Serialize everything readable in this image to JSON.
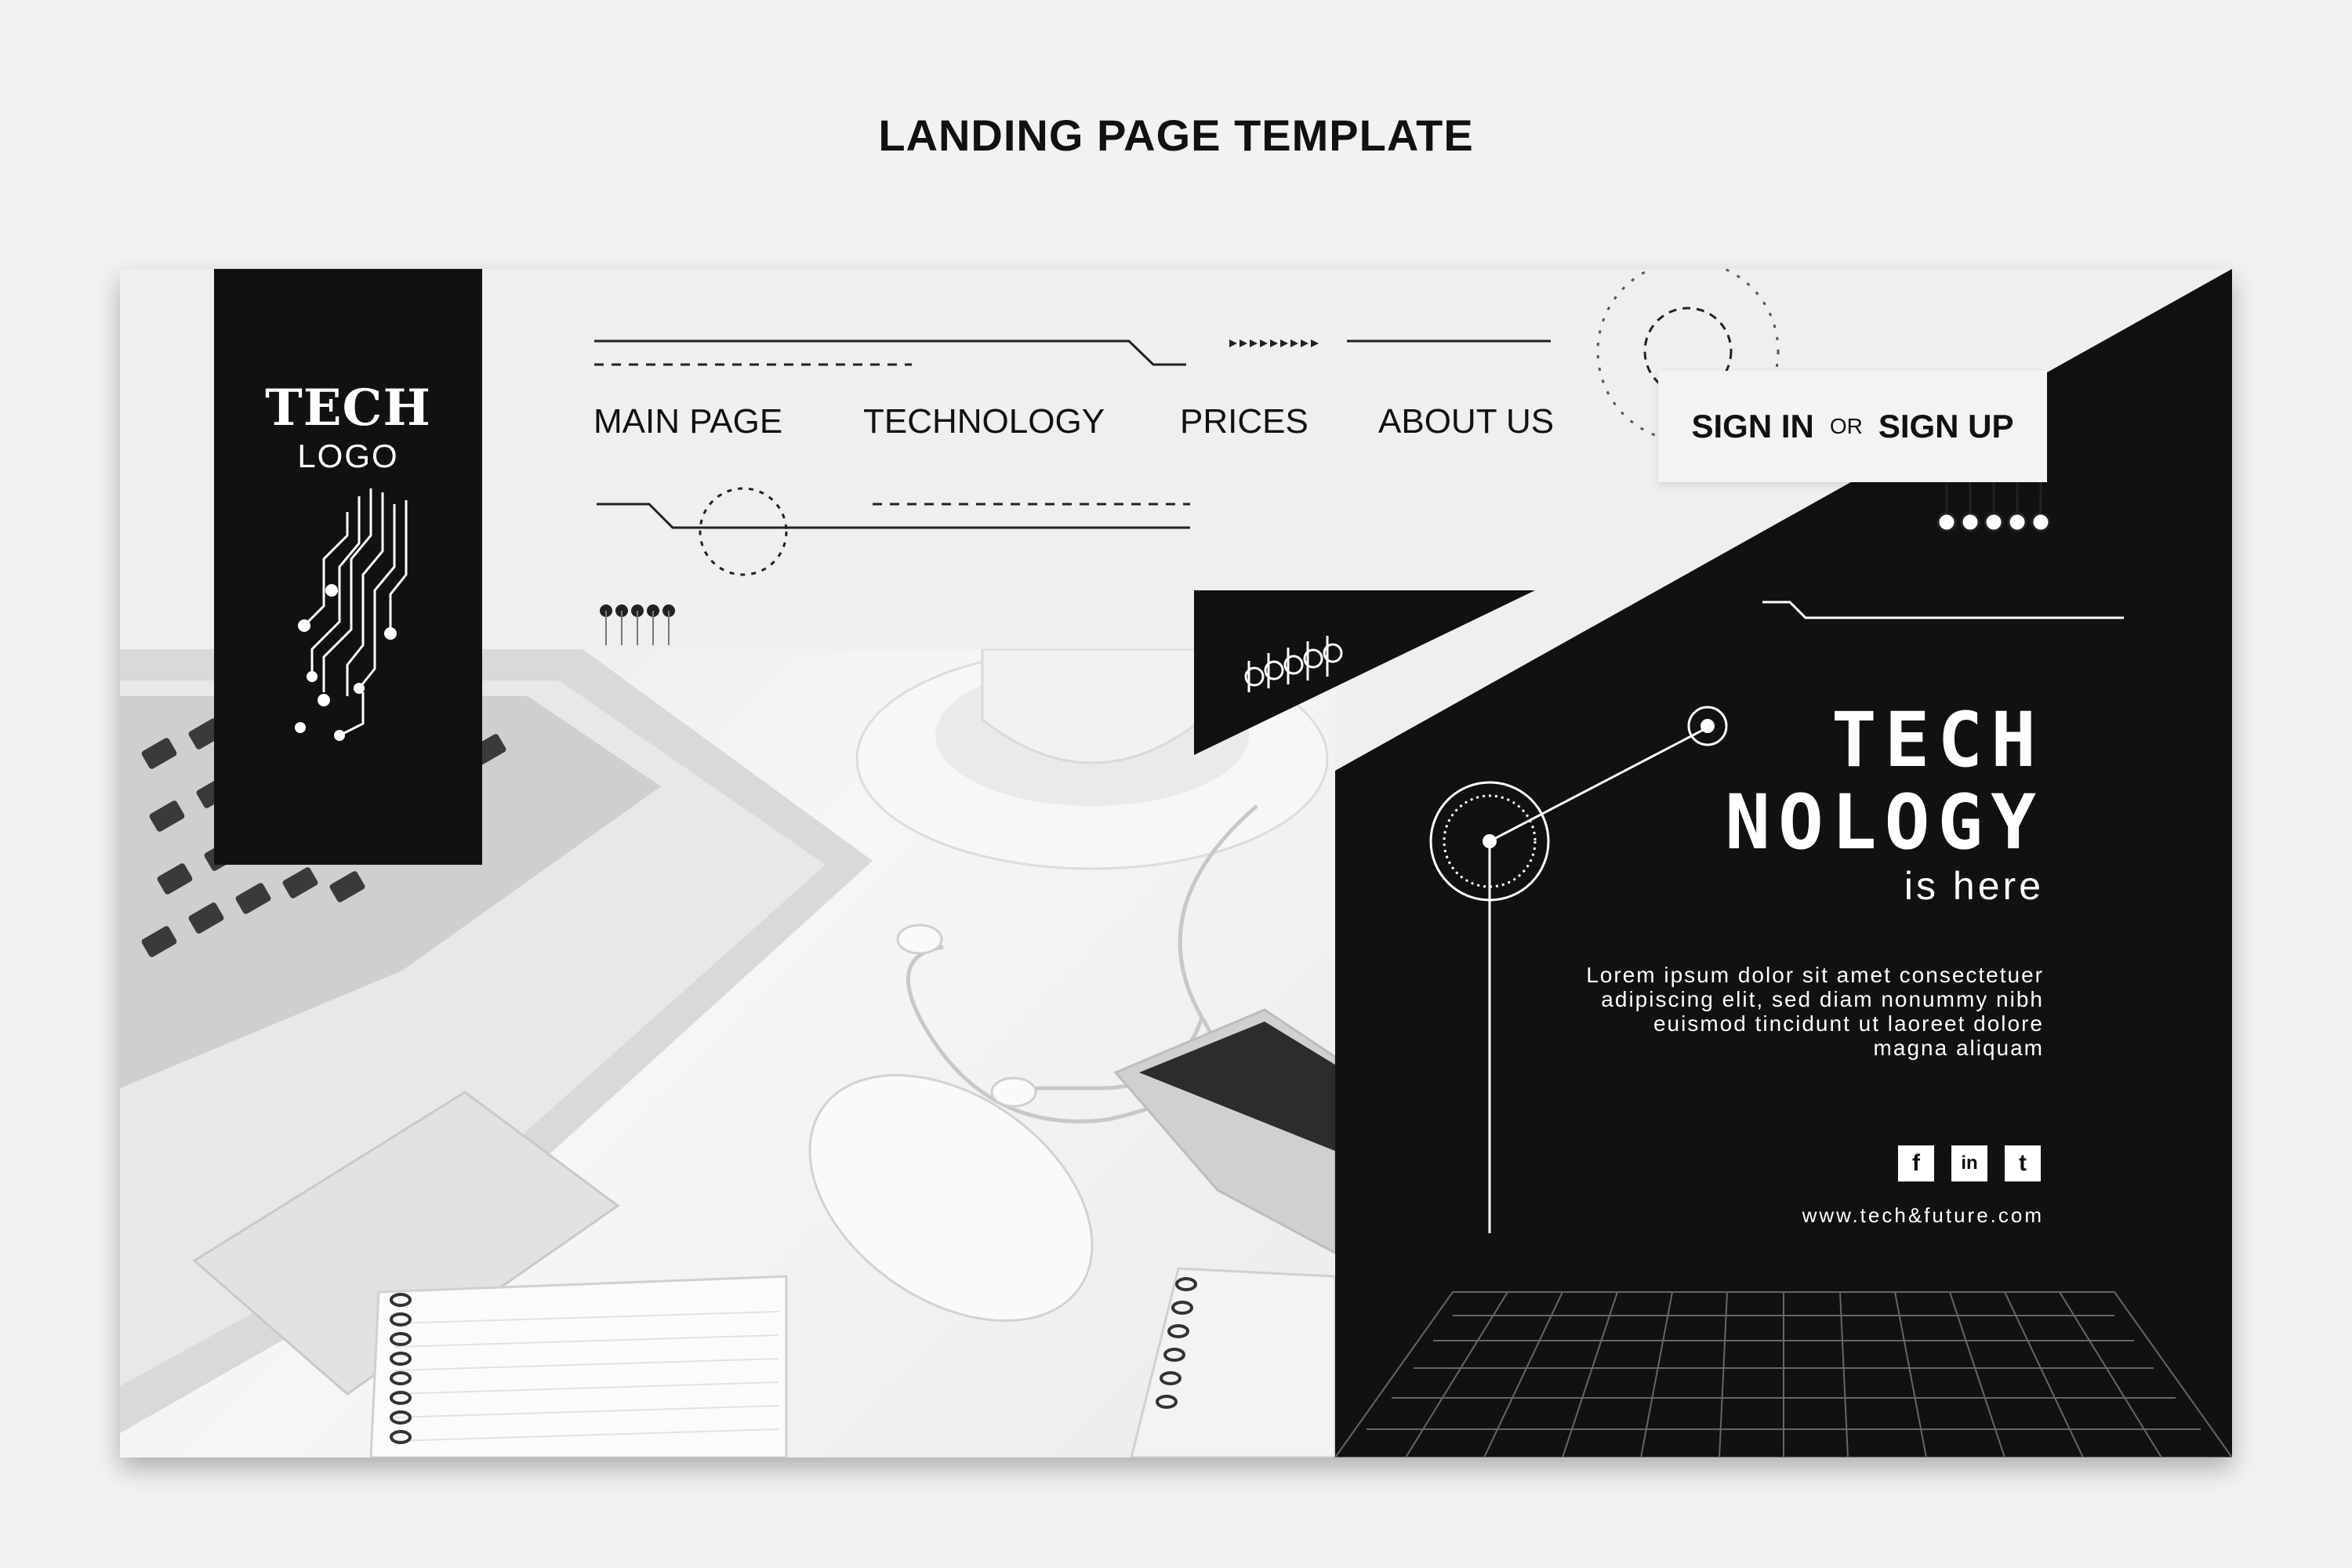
{
  "heading": "LANDING PAGE TEMPLATE",
  "logo": {
    "title": "TECH",
    "subtitle": "LOGO"
  },
  "nav": {
    "items": [
      {
        "label": "MAIN PAGE"
      },
      {
        "label": "TECHNOLOGY"
      },
      {
        "label": "PRICES"
      },
      {
        "label": "ABOUT US"
      }
    ]
  },
  "auth": {
    "sign_in": "SIGN IN",
    "or": "OR",
    "sign_up": "SIGN UP"
  },
  "hero": {
    "line1": "TECH",
    "line2": "NOLOGY",
    "line3": "is here",
    "body": "Lorem ipsum dolor sit amet consectetuer adipiscing elit, sed diam nonummy nibh euismod tincidunt ut laoreet dolore magna aliquam"
  },
  "social": [
    {
      "icon": "facebook-icon",
      "glyph": "f"
    },
    {
      "icon": "linkedin-icon",
      "glyph": "in"
    },
    {
      "icon": "twitter-icon",
      "glyph": "t"
    }
  ],
  "website": "www.tech&future.com",
  "colors": {
    "dark": "#111111",
    "light": "#efefef",
    "background": "#f2f2f2"
  }
}
